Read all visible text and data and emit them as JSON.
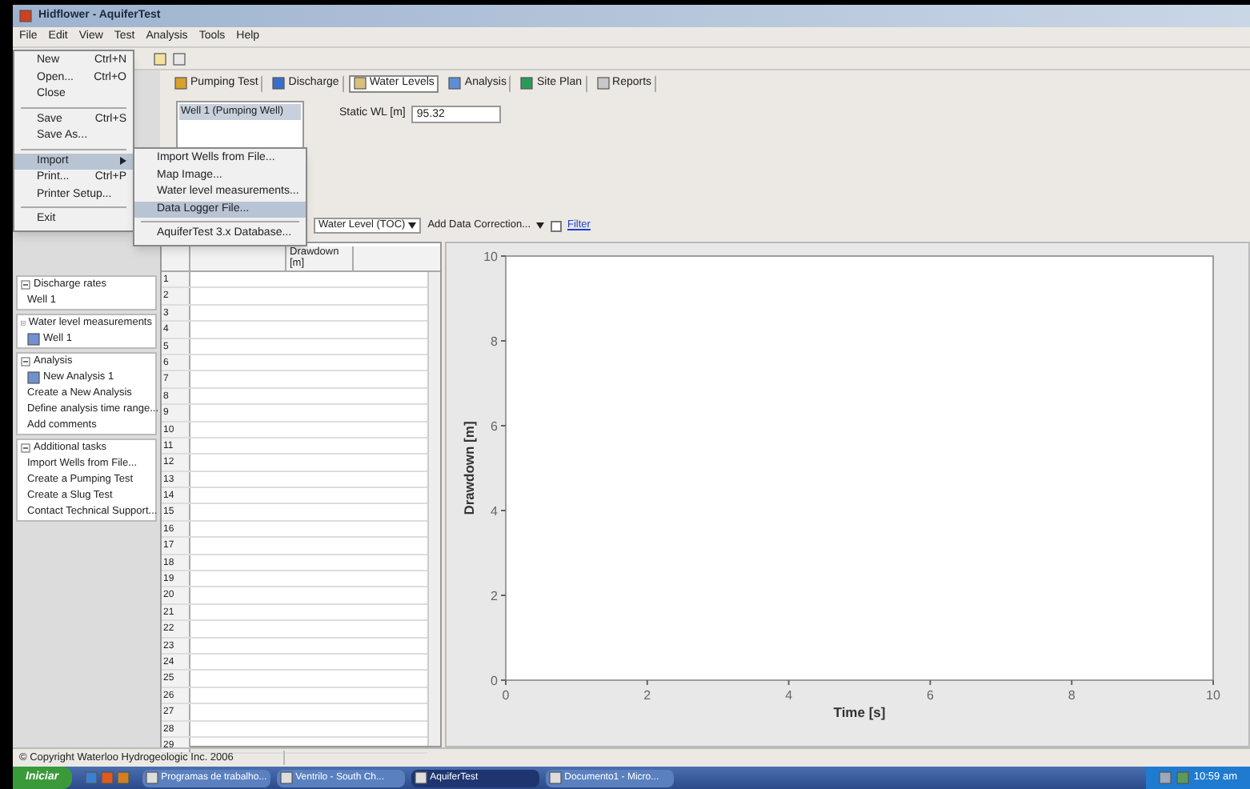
{
  "window": {
    "title": "Hidflower - AquiferTest"
  },
  "menu_bar": [
    "File",
    "Edit",
    "View",
    "Test",
    "Analysis",
    "Tools",
    "Help"
  ],
  "file_menu": [
    {
      "kind": "item",
      "label": "New",
      "shortcut": "Ctrl+N",
      "selected": false
    },
    {
      "kind": "item",
      "label": "Open...",
      "shortcut": "Ctrl+O",
      "selected": false
    },
    {
      "kind": "item",
      "label": "Close",
      "selected": false
    },
    {
      "kind": "separator"
    },
    {
      "kind": "item",
      "label": "Save",
      "shortcut": "Ctrl+S",
      "selected": false
    },
    {
      "kind": "item",
      "label": "Save As...",
      "selected": false
    },
    {
      "kind": "separator"
    },
    {
      "kind": "submenu",
      "label": "Import",
      "selected": true
    },
    {
      "kind": "item",
      "label": "Print...",
      "shortcut": "Ctrl+P",
      "selected": false
    },
    {
      "kind": "item",
      "label": "Printer Setup...",
      "selected": false
    },
    {
      "kind": "separator"
    },
    {
      "kind": "item",
      "label": "Exit",
      "selected": false
    }
  ],
  "import_submenu": [
    {
      "kind": "item",
      "label": "Import Wells from File...",
      "selected": false
    },
    {
      "kind": "item",
      "label": "Map Image...",
      "selected": false
    },
    {
      "kind": "item",
      "label": "Water level measurements...",
      "selected": false
    },
    {
      "kind": "item",
      "label": "Data Logger File...",
      "selected": true
    },
    {
      "kind": "separator"
    },
    {
      "kind": "item",
      "label": "AquiferTest 3.x Database...",
      "selected": false
    }
  ],
  "tabs": [
    {
      "label": "Pumping Test",
      "selected": false
    },
    {
      "label": "Discharge",
      "selected": false
    },
    {
      "label": "Water Levels",
      "selected": true
    },
    {
      "label": "Analysis",
      "selected": false
    },
    {
      "label": "Site Plan",
      "selected": false
    },
    {
      "label": "Reports",
      "selected": false
    }
  ],
  "wells": [
    {
      "label": "Well 1 (Pumping Well)",
      "selected": true
    }
  ],
  "static_wl": {
    "label": "Static WL [m]",
    "value": "95.32"
  },
  "data_toolbar": {
    "level_type": "Water Level (TOC)",
    "correction": "Add Data Correction...",
    "filter": {
      "label": "Filter",
      "checked": false
    }
  },
  "table": {
    "columns": [
      "Drawdown [m]"
    ],
    "row_numbers": [
      "1",
      "2",
      "3",
      "4",
      "5",
      "6",
      "7",
      "8",
      "9",
      "10",
      "11",
      "12",
      "13",
      "14",
      "15",
      "16",
      "17",
      "18",
      "19",
      "20",
      "21",
      "22",
      "23",
      "24",
      "25",
      "26",
      "27",
      "28",
      "29"
    ]
  },
  "task_panel": [
    {
      "title": "Discharge rates",
      "items": [
        {
          "kind": "task",
          "label": "Well 1"
        }
      ]
    },
    {
      "title": "Water level measurements",
      "items": [
        {
          "kind": "data",
          "label": "Well 1"
        }
      ]
    },
    {
      "title": "Analysis",
      "items": [
        {
          "kind": "data",
          "label": "New Analysis 1"
        },
        {
          "kind": "task",
          "label": "Create a New Analysis"
        },
        {
          "kind": "task",
          "label": "Define analysis time range..."
        },
        {
          "kind": "task",
          "label": "Add comments"
        }
      ]
    },
    {
      "title": "Additional tasks",
      "items": [
        {
          "kind": "task",
          "label": "Import Wells from File..."
        },
        {
          "kind": "task",
          "label": "Create a Pumping Test"
        },
        {
          "kind": "task",
          "label": "Create a Slug Test"
        },
        {
          "kind": "task",
          "label": "Contact Technical Support..."
        }
      ]
    }
  ],
  "chart": {
    "chart_data": {
      "type": "scatter",
      "xlabel": "Time [s]",
      "ylabel": "Drawdown [m]",
      "xlim": [
        0,
        10
      ],
      "ylim": [
        0,
        10
      ],
      "xticks": [
        0,
        2,
        4,
        6,
        8,
        10
      ],
      "yticks": [
        0,
        2,
        4,
        6,
        8,
        10
      ]
    }
  },
  "status_bar": "© Copyright Waterloo Hydrogeologic Inc. 2006",
  "taskbar": {
    "start": "Iniciar",
    "tasks": [
      {
        "label": "Programas de trabalho...",
        "selected": false
      },
      {
        "label": "Ventrilo - South Ch...",
        "selected": false
      },
      {
        "label": "AquiferTest",
        "selected": true
      },
      {
        "label": "Documento1 - Micro...",
        "selected": false
      }
    ],
    "clock": "10:59 am"
  }
}
